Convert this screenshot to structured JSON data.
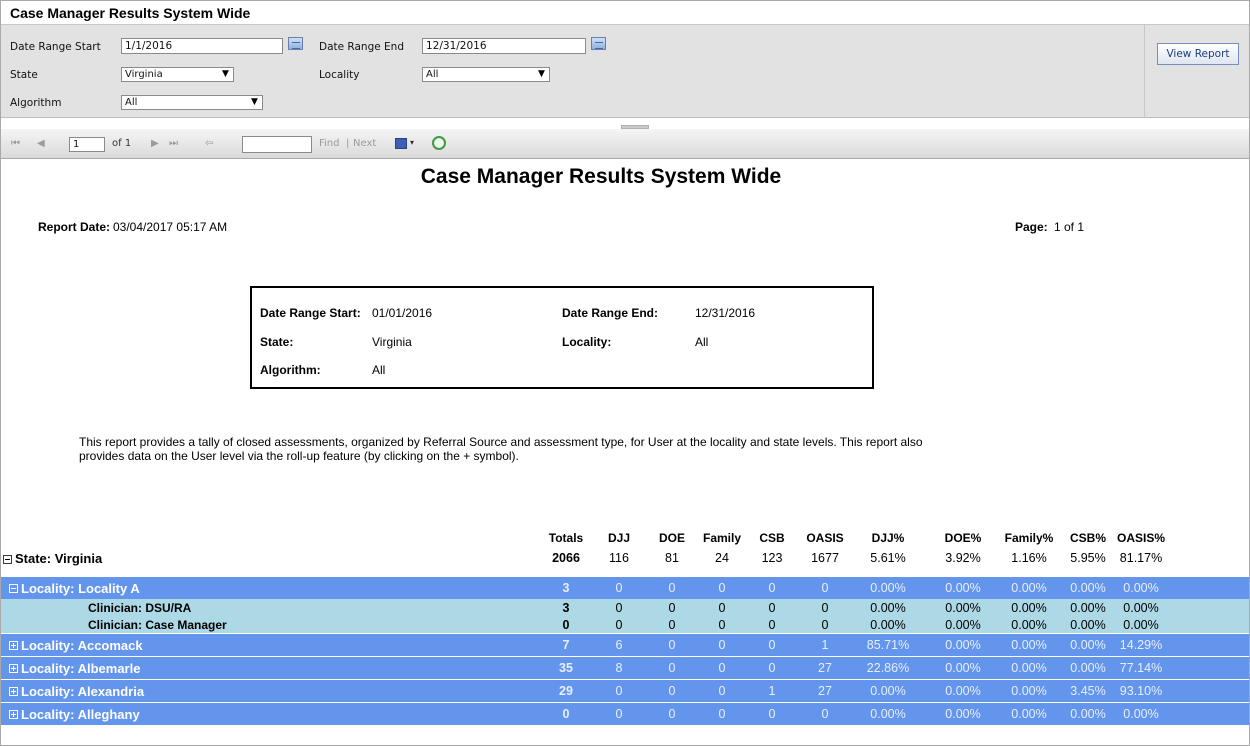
{
  "window": {
    "title": "Case Manager Results System Wide"
  },
  "params": {
    "date_start_label": "Date Range Start",
    "date_start_value": "1/1/2016",
    "date_end_label": "Date Range End",
    "date_end_value": "12/31/2016",
    "state_label": "State",
    "state_value": "Virginia",
    "locality_label": "Locality",
    "locality_value": "All",
    "algorithm_label": "Algorithm",
    "algorithm_value": "All",
    "view_report_label": "View Report"
  },
  "toolbar": {
    "first": "⏮",
    "prev": "◀",
    "page_value": "1",
    "of_label": "of 1",
    "next": "▶",
    "last": "⏭",
    "back": "⇦",
    "find_label": "Find",
    "separator": "|",
    "next_label": "Next",
    "export_arrow": "▾"
  },
  "report": {
    "title": "Case Manager Results System Wide",
    "report_date_label": "Report Date:",
    "report_date_value": "03/04/2017  05:17 AM",
    "page_label": "Page:",
    "page_value": "1 of 1",
    "criteria": {
      "date_start_label": "Date Range Start:",
      "date_start_value": "01/01/2016",
      "date_end_label": "Date Range End:",
      "date_end_value": "12/31/2016",
      "state_label": "State:",
      "state_value": "Virginia",
      "locality_label": "Locality:",
      "locality_value": "All",
      "algorithm_label": "Algorithm:",
      "algorithm_value": "All"
    },
    "description": "This report provides a tally of closed assessments, organized by Referral Source and assessment type, for User at the locality and state levels. This report also provides data on the User level via the roll-up feature (by clicking on the + symbol).",
    "columns": [
      "Totals",
      "DJJ",
      "DOE",
      "Family",
      "CSB",
      "OASIS",
      "DJJ%",
      "DOE%",
      "Family%",
      "CSB%",
      "OASIS%"
    ],
    "state_row": {
      "label": "State:  Virginia",
      "values": [
        "2066",
        "116",
        "81",
        "24",
        "123",
        "1677",
        "5.61%",
        "3.92%",
        "1.16%",
        "5.95%",
        "81.17%"
      ]
    },
    "rows": [
      {
        "type": "loc",
        "toggle": "minus",
        "label": "Locality:  Locality A",
        "values": [
          "3",
          "0",
          "0",
          "0",
          "0",
          "0",
          "0.00%",
          "0.00%",
          "0.00%",
          "0.00%",
          "0.00%"
        ]
      },
      {
        "type": "clin",
        "label": "Clinician:  DSU/RA",
        "values": [
          "3",
          "0",
          "0",
          "0",
          "0",
          "0",
          "0.00%",
          "0.00%",
          "0.00%",
          "0.00%",
          "0.00%"
        ]
      },
      {
        "type": "clin",
        "label": "Clinician:  Case Manager",
        "values": [
          "0",
          "0",
          "0",
          "0",
          "0",
          "0",
          "0.00%",
          "0.00%",
          "0.00%",
          "0.00%",
          "0.00%"
        ]
      },
      {
        "type": "loc",
        "toggle": "plus",
        "label": "Locality:  Accomack",
        "values": [
          "7",
          "6",
          "0",
          "0",
          "0",
          "1",
          "85.71%",
          "0.00%",
          "0.00%",
          "0.00%",
          "14.29%"
        ]
      },
      {
        "type": "loc",
        "toggle": "plus",
        "label": "Locality:  Albemarle",
        "values": [
          "35",
          "8",
          "0",
          "0",
          "0",
          "27",
          "22.86%",
          "0.00%",
          "0.00%",
          "0.00%",
          "77.14%"
        ]
      },
      {
        "type": "loc",
        "toggle": "plus",
        "label": "Locality:  Alexandria",
        "values": [
          "29",
          "0",
          "0",
          "0",
          "1",
          "27",
          "0.00%",
          "0.00%",
          "0.00%",
          "3.45%",
          "93.10%"
        ]
      },
      {
        "type": "loc",
        "toggle": "plus",
        "label": "Locality:  Alleghany",
        "values": [
          "0",
          "0",
          "0",
          "0",
          "0",
          "0",
          "0.00%",
          "0.00%",
          "0.00%",
          "0.00%",
          "0.00%"
        ]
      }
    ]
  }
}
